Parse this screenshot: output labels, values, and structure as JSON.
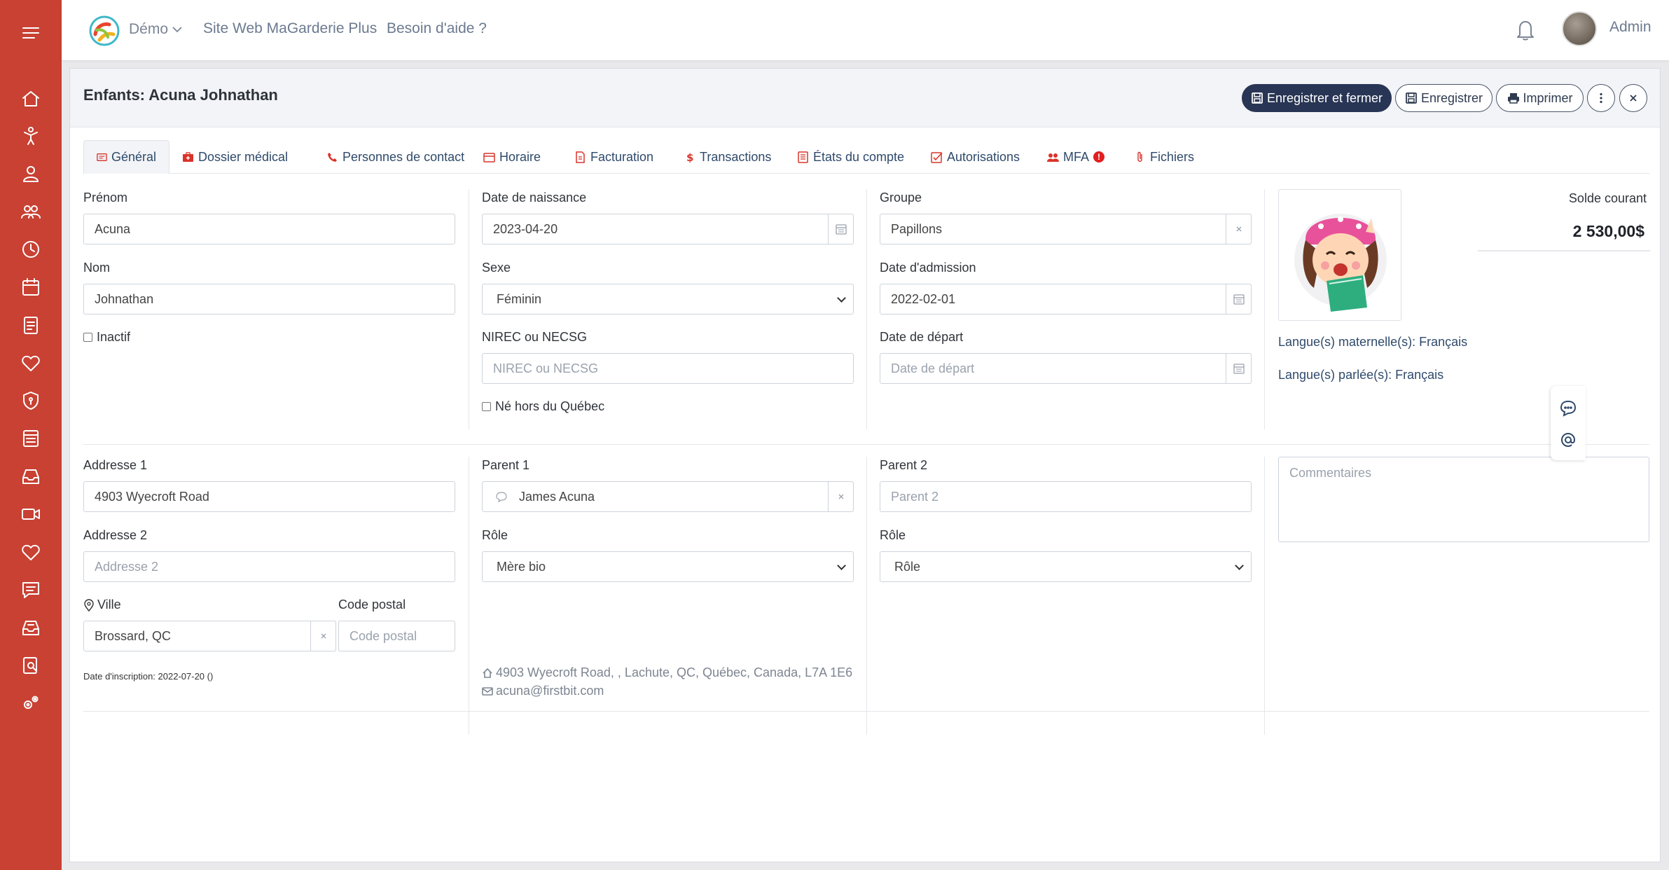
{
  "topbar": {
    "demo_label": "Démo",
    "link_site": "Site Web MaGarderie Plus",
    "link_help": "Besoin d'aide ?",
    "user_name": "Admin"
  },
  "sidebar": {
    "icons": [
      "menu-icon",
      "home-icon",
      "child-icon",
      "person-icon",
      "group-icon",
      "clock-icon",
      "calendar-icon",
      "report-icon",
      "heart-icon",
      "shield-icon",
      "list-icon",
      "inbox-icon",
      "video-icon",
      "heart-outline-icon",
      "message-icon",
      "archive-icon",
      "document-search-icon",
      "settings-icon"
    ]
  },
  "header": {
    "title": "Enfants: Acuna Johnathan",
    "btn_save_close": "Enregistrer et fermer",
    "btn_save": "Enregistrer",
    "btn_print": "Imprimer"
  },
  "tabs": [
    {
      "label": "Général"
    },
    {
      "label": "Dossier médical"
    },
    {
      "label": "Personnes de contact"
    },
    {
      "label": "Horaire"
    },
    {
      "label": "Facturation"
    },
    {
      "label": "Transactions"
    },
    {
      "label": "États du compte"
    },
    {
      "label": "Autorisations"
    },
    {
      "label": "MFA"
    },
    {
      "label": "Fichiers"
    }
  ],
  "mfa_badge": "!",
  "form": {
    "prenom_label": "Prénom",
    "prenom_value": "Acuna",
    "nom_label": "Nom",
    "nom_value": "Johnathan",
    "inactif_label": "Inactif",
    "naissance_label": "Date de naissance",
    "naissance_value": "2023-04-20",
    "sexe_label": "Sexe",
    "sexe_value": "Féminin",
    "nirec_label": "NIREC ou NECSG",
    "nirec_placeholder": "NIREC ou NECSG",
    "hors_quebec_label": "Né hors du Québec",
    "groupe_label": "Groupe",
    "groupe_value": "Papillons",
    "admission_label": "Date d'admission",
    "admission_value": "2022-02-01",
    "depart_label": "Date de départ",
    "depart_placeholder": "Date de départ",
    "solde_label": "Solde courant",
    "solde_value": "2 530,00$",
    "langue_maternelle": "Langue(s) maternelle(s): Français",
    "langue_parlee": "Langue(s) parlée(s): Français",
    "adresse1_label": "Addresse 1",
    "adresse1_value": "4903 Wyecroft Road",
    "adresse2_label": "Addresse 2",
    "adresse2_placeholder": "Addresse 2",
    "ville_label": "Ville",
    "ville_value": "Brossard, QC",
    "code_postal_label": "Code postal",
    "code_postal_placeholder": "Code postal",
    "inscription_text": "Date d'inscription: 2022-07-20 ()",
    "parent1_label": "Parent 1",
    "parent1_value": "James Acuna",
    "role1_label": "Rôle",
    "role1_value": "Mère bio",
    "parent1_address": "4903 Wyecroft Road, , Lachute, QC, Québec, Canada, L7A 1E6",
    "parent1_email": "acuna@firstbit.com",
    "parent2_label": "Parent 2",
    "parent2_placeholder": "Parent 2",
    "role2_label": "Rôle",
    "role2_value": "Rôle",
    "comments_placeholder": "Commentaires"
  },
  "colors": {
    "sidebar": "#c84133",
    "primary_button": "#283554",
    "link": "#2f4a6b",
    "tab_icon": "#d9342b"
  }
}
